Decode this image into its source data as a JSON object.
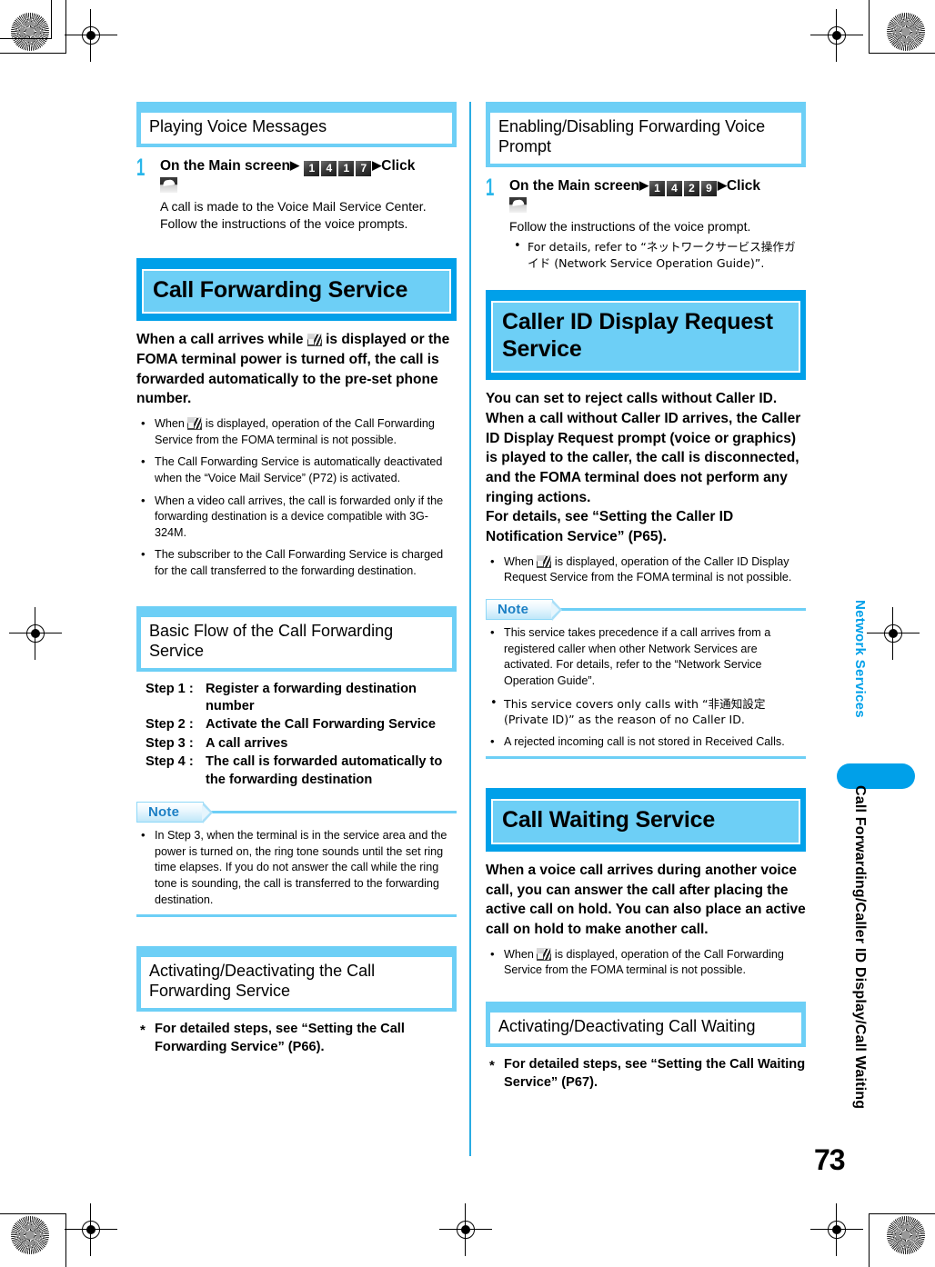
{
  "page": {
    "number": "73",
    "running_head": "Call Forwarding/Caller ID Display/Call Waiting",
    "chapter_label": "Network Services",
    "accent_blue": "#00a0e9",
    "light_blue": "#6dcff6"
  },
  "left_column": {
    "section_playing_voice": {
      "heading": "Playing Voice Messages",
      "step": {
        "number": "1",
        "head_prefix": "On the Main screen",
        "keys": [
          "1",
          "4",
          "1",
          "7"
        ],
        "head_suffix": "Click",
        "icon": "call-icon",
        "body_line1": "A call is made to the Voice Mail Service Center.",
        "body_line2": "Follow the instructions of the voice prompts."
      }
    },
    "section_call_forwarding": {
      "heading": "Call Forwarding Service",
      "lead_part1": "When a call arrives while",
      "lead_icon": "call-forward-status-icon",
      "lead_part2": "is displayed or the FOMA terminal power is turned off, the call is forwarded automatically to the pre-set phone number.",
      "bullets": [
        {
          "pre": "When",
          "icon": "call-forward-status-icon",
          "post": "is displayed, operation of the Call Forwarding Service from the FOMA terminal is not possible."
        },
        {
          "text": "The Call Forwarding Service is automatically deactivated when the “Voice Mail Service” (P72) is activated."
        },
        {
          "text": "When a video call arrives, the call is forwarded only if the forwarding destination is a device compatible with 3G-324M."
        },
        {
          "text": "The subscriber to the Call Forwarding Service is charged for the call transferred to the forwarding destination."
        }
      ]
    },
    "section_basic_flow": {
      "heading": "Basic Flow of the Call Forwarding Service",
      "steps": [
        {
          "label": "Step 1 :",
          "value": "Register a forwarding destination number"
        },
        {
          "label": "Step 2 :",
          "value": "Activate the Call Forwarding Service"
        },
        {
          "label": "Step 3 :",
          "value": "A call arrives"
        },
        {
          "label": "Step 4 :",
          "value": "The call is forwarded automatically to the forwarding destination"
        }
      ],
      "note": {
        "label": "Note",
        "bullets": [
          "In Step 3, when the terminal is in the service area and the power is turned on, the ring tone sounds until the set ring time elapses. If you do not answer the call while the ring tone is sounding, the call is transferred to the forwarding destination."
        ]
      }
    },
    "section_activating": {
      "heading": "Activating/Deactivating the Call Forwarding Service",
      "starnote": "For detailed steps, see “Setting the Call Forwarding Service” (P66)."
    }
  },
  "right_column": {
    "section_enabling_prompt": {
      "heading": "Enabling/Disabling Forwarding Voice Prompt",
      "step": {
        "number": "1",
        "head_prefix": "On the Main screen",
        "keys": [
          "1",
          "4",
          "2",
          "9"
        ],
        "head_suffix": "Click",
        "icon": "call-icon",
        "body_line1": "Follow the instructions of the voice prompt.",
        "bullets": [
          "For details, refer to “ネットワークサービス操作ガイド (Network Service Operation Guide)”."
        ]
      }
    },
    "section_caller_id": {
      "heading": "Caller ID Display Request Service",
      "lead": "You can set to reject calls without Caller ID.\nWhen a call without Caller ID arrives, the Caller ID Display Request prompt (voice or graphics) is played to the caller, the call is disconnected, and the FOMA terminal does not perform any ringing actions.\nFor details, see “Setting the Caller ID Notification Service” (P65).",
      "bullets": [
        {
          "pre": "When",
          "icon": "call-forward-status-icon",
          "post": "is displayed, operation of the Caller ID Display Request Service from the FOMA terminal is not possible."
        }
      ],
      "note": {
        "label": "Note",
        "bullets": [
          "This service takes precedence if a call arrives from a registered caller when other Network Services are activated. For details, refer to the “Network Service Operation Guide”.",
          "This service covers only calls with “非通知設定 (Private ID)” as the reason of no Caller ID.",
          "A rejected incoming call is not stored in Received Calls."
        ]
      }
    },
    "section_call_waiting": {
      "heading": "Call Waiting Service",
      "lead": "When a voice call arrives during another voice call, you can answer the call after placing the active call on hold. You can also place an active call on hold to make another call.",
      "bullets": [
        {
          "pre": "When",
          "icon": "call-forward-status-icon",
          "post": "is displayed, operation of the Call Forwarding Service from the FOMA terminal is not possible."
        }
      ]
    },
    "section_activating_cw": {
      "heading": "Activating/Deactivating Call Waiting",
      "starnote": "For detailed steps, see “Setting the Call Waiting Service” (P67)."
    }
  }
}
